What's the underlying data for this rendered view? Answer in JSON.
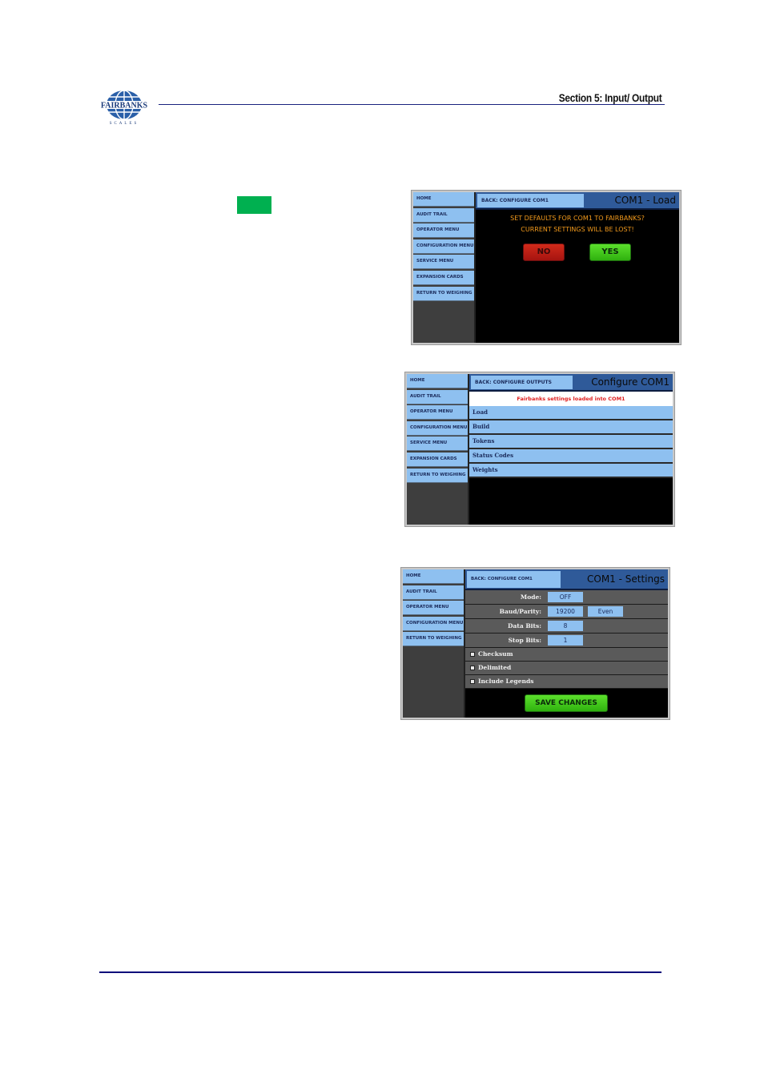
{
  "header": {
    "logo_text": "FAIRBANKS",
    "logo_subtext": "SCALES",
    "section_title": "Section 5: Input/ Output"
  },
  "colors": {
    "rule_blue": "#0a0a7a",
    "swatch_green": "#00b050",
    "nav_blue": "#8ec0f0",
    "title_blue": "#2f5a99",
    "prompt_orange": "#f39a1c",
    "message_red": "#e02020"
  },
  "screen1": {
    "sidebar": [
      "HOME",
      "AUDIT TRAIL",
      "OPERATOR MENU",
      "CONFIGURATION MENU",
      "SERVICE MENU",
      "EXPANSION CARDS",
      "RETURN TO WEIGHING"
    ],
    "back_label": "BACK: CONFIGURE COM1",
    "title": "COM1 - Load",
    "prompt_line1": "SET DEFAULTS FOR COM1 TO FAIRBANKS?",
    "prompt_line2": "CURRENT SETTINGS WILL BE LOST!",
    "no_label": "NO",
    "yes_label": "YES"
  },
  "screen2": {
    "sidebar": [
      "HOME",
      "AUDIT TRAIL",
      "OPERATOR MENU",
      "CONFIGURATION MENU",
      "SERVICE MENU",
      "EXPANSION CARDS",
      "RETURN TO WEIGHING"
    ],
    "back_label": "BACK: CONFIGURE OUTPUTS",
    "title": "Configure COM1",
    "message": "Fairbanks settings loaded into COM1",
    "items": [
      "Load",
      "Build",
      "Tokens",
      "Status Codes",
      "Weights"
    ]
  },
  "screen3": {
    "sidebar": [
      "HOME",
      "AUDIT TRAIL",
      "OPERATOR MENU",
      "CONFIGURATION MENU",
      "RETURN TO WEIGHING"
    ],
    "back_label": "BACK: CONFIGURE COM1",
    "title": "COM1 - Settings",
    "mode_label": "Mode:",
    "mode_value": "OFF",
    "baud_label": "Baud/Parity:",
    "baud_value": "19200",
    "parity_value": "Even",
    "data_bits_label": "Data Bits:",
    "data_bits_value": "8",
    "stop_bits_label": "Stop Bits:",
    "stop_bits_value": "1",
    "checkboxes": [
      "Checksum",
      "Delimited",
      "Include Legends"
    ],
    "save_label": "SAVE CHANGES"
  }
}
